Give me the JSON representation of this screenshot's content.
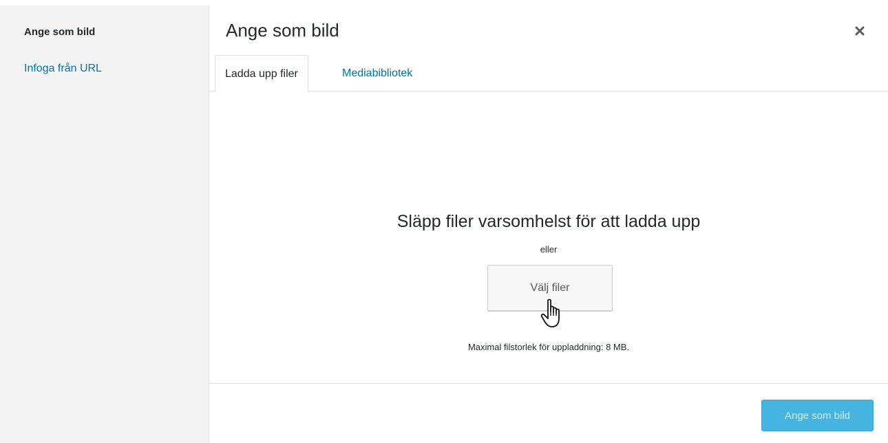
{
  "sidebar": {
    "items": [
      {
        "label": "Ange som bild",
        "state": "active"
      },
      {
        "label": "Infoga från URL",
        "state": "link"
      }
    ]
  },
  "modal": {
    "title": "Ange som bild",
    "close_icon": "close-icon"
  },
  "tabs": [
    {
      "label": "Ladda upp filer",
      "active": true
    },
    {
      "label": "Mediabibliotek",
      "active": false
    }
  ],
  "uploader": {
    "drop_text": "Släpp filer varsomhelst för att ladda upp",
    "or_text": "eller",
    "select_button": "Välj filer",
    "max_size_text": "Maximal filstorlek för uppladdning: 8 MB."
  },
  "footer": {
    "primary_button": "Ange som bild"
  },
  "colors": {
    "link": "#0073aa",
    "primary_disabled": "#46b4e0",
    "sidebar_bg": "#f3f3f3"
  }
}
